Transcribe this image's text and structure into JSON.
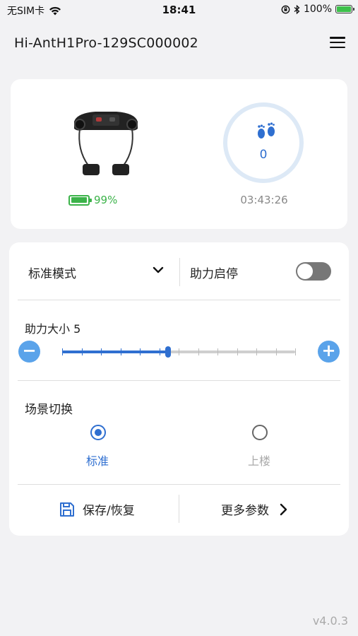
{
  "status_bar": {
    "carrier": "无SIM卡",
    "time": "18:41",
    "battery": "100%"
  },
  "header": {
    "device_name": "Hi-AntH1Pro-129SC000002",
    "menu_icon": "hamburger-menu-icon"
  },
  "device_card": {
    "battery_percent": "99%",
    "battery_level": 0.99,
    "step_count": "0",
    "duration": "03:43:26"
  },
  "controls": {
    "mode_label": "标准模式",
    "assist_toggle_label": "助力启停",
    "assist_enabled": false,
    "assist_level_label": "助力大小 5",
    "assist_level_value": 5,
    "assist_level_max": 12,
    "scene_label": "场景切换",
    "scene_options": [
      "标准",
      "上楼"
    ],
    "scene_selected": "标准",
    "save_label": "保存/恢复",
    "more_label": "更多参数"
  },
  "footer": {
    "version": "v4.0.3"
  },
  "colors": {
    "accent": "#2f6fd0",
    "light_accent": "#5aa3ea",
    "battery_green": "#3cb34a"
  }
}
